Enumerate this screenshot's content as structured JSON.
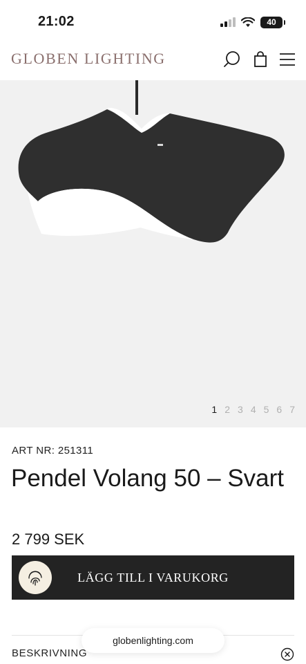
{
  "status_bar": {
    "time": "21:02",
    "battery": "40",
    "icons": [
      "signal-icon",
      "wifi-icon",
      "battery-icon"
    ]
  },
  "header": {
    "logo": "GLOBEN LIGHTING",
    "icons": [
      "search-icon",
      "cart-icon",
      "menu-icon"
    ]
  },
  "gallery": {
    "pages": [
      "1",
      "2",
      "3",
      "4",
      "5",
      "6",
      "7"
    ],
    "active_page": "1",
    "background": "#f1f1f1"
  },
  "product": {
    "art_nr": "ART NR: 251311",
    "title": "Pendel Volang 50 – Svart",
    "price": "2 799 SEK"
  },
  "cart_button": {
    "label": "LÄGG TILL I VARUKORG",
    "color": "#232323"
  },
  "description": {
    "label": "BESKRIVNING"
  },
  "browser": {
    "url": "globenlighting.com"
  },
  "colors": {
    "logo": "#8a6f6d",
    "accent": "#f5efe2"
  }
}
